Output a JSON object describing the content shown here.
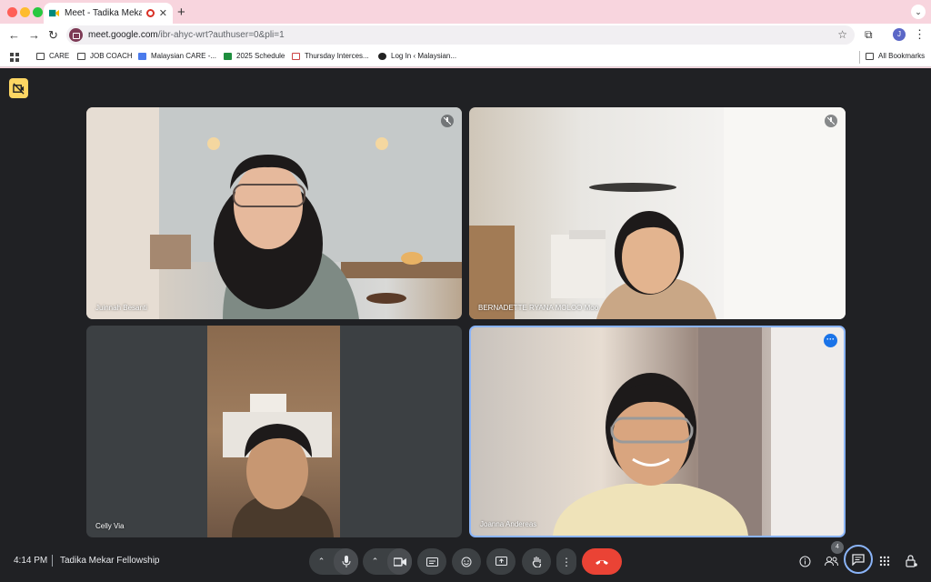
{
  "browser": {
    "tab_title": "Meet - Tadika Mekar Fello",
    "url_host": "meet.google.com",
    "url_path": "/ibr-ahyc-wrt?authuser=0&pli=1",
    "profile_initial": "J",
    "bookmarks": [
      "CARE",
      "JOB COACH",
      "Malaysian CARE -...",
      "2025 Schedule",
      "Thursday Interces...",
      "Log In ‹ Malaysian..."
    ],
    "all_bookmarks": "All Bookmarks"
  },
  "colors": {
    "chrome_bg": "#f8d5de",
    "meet_bg": "#202124",
    "active_speaker_border": "#8ab4f8",
    "hangup": "#ea4335",
    "hidden_badge": "#fdd663"
  },
  "participants": [
    {
      "name": "Juinnah Besanti",
      "muted": true
    },
    {
      "name": "BERNADETTE RYANA MOLOO Moo",
      "muted": true
    },
    {
      "name": "Celly Via",
      "muted": false
    },
    {
      "name": "Joanna Andereas",
      "muted": false,
      "active": true
    }
  ],
  "footer": {
    "time": "4:14 PM",
    "meeting_name": "Tadika Mekar Fellowship",
    "people_count": "4"
  },
  "icons": {
    "hidden": "video-hidden-icon",
    "mic": "mic-icon",
    "camera": "camera-icon",
    "captions": "captions-icon",
    "emoji": "emoji-icon",
    "present": "present-icon",
    "hand": "raise-hand-icon",
    "more": "more-options-icon",
    "hangup": "hangup-icon",
    "info": "info-icon",
    "people": "people-icon",
    "chat": "chat-icon",
    "activities": "activities-icon",
    "host": "host-controls-icon"
  }
}
